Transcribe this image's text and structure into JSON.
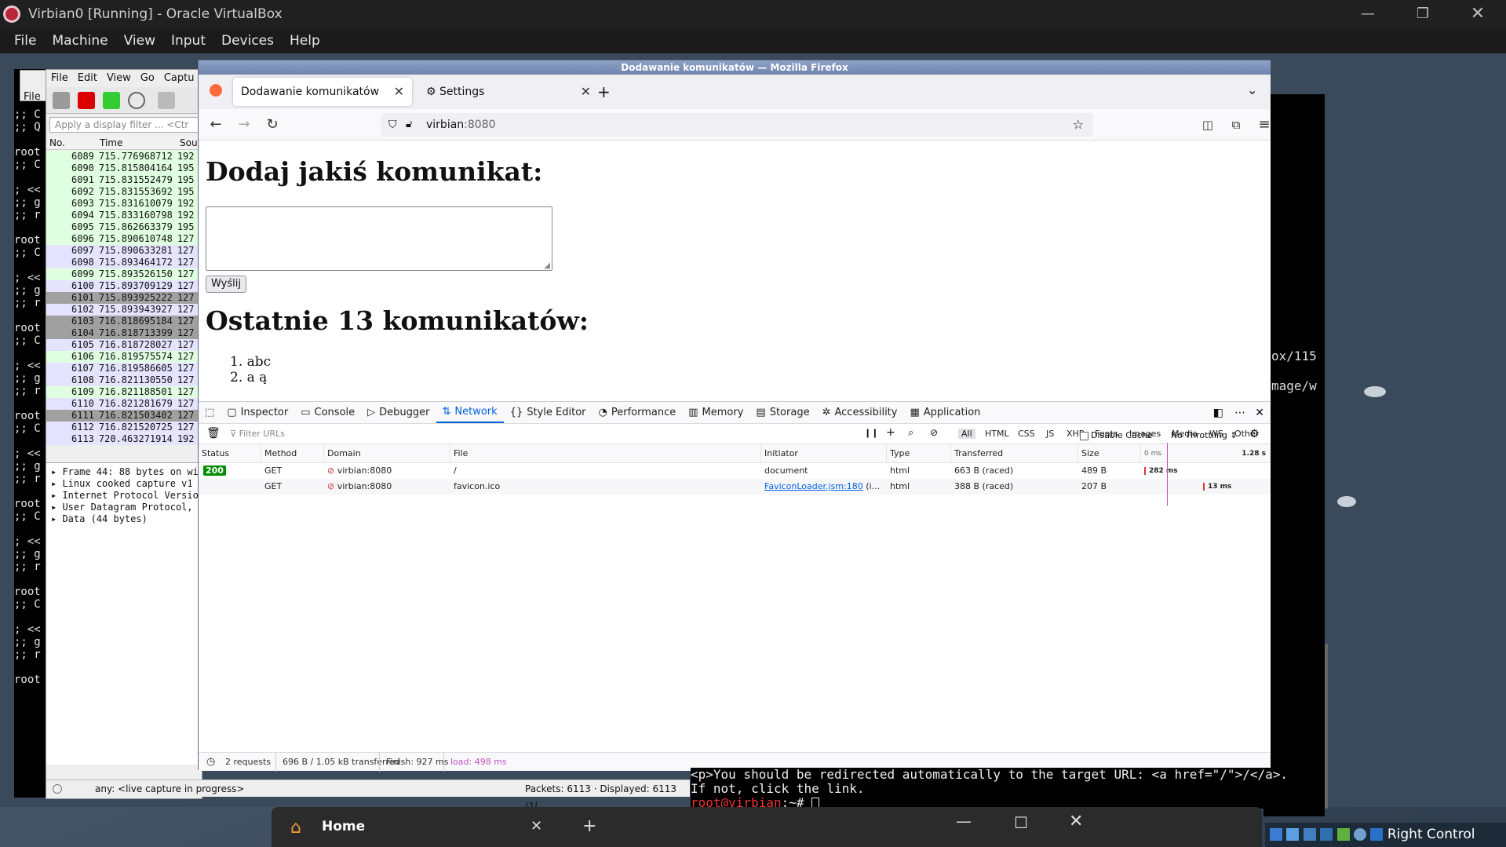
{
  "vbox": {
    "title": "Virbian0 [Running] - Oracle VirtualBox",
    "menu": [
      "File",
      "Machine",
      "View",
      "Input",
      "Devices",
      "Help"
    ],
    "host_key": "Right Control"
  },
  "term_left": {
    "lines": [
      ";; C",
      ";; Q",
      "",
      "root",
      ";; C",
      "",
      "; <<",
      ";; g",
      ";; r",
      "",
      "root",
      ";; C",
      "",
      "; <<",
      ";; g",
      ";; r",
      "",
      "root",
      ";; C",
      "",
      "; <<",
      ";; g",
      ";; r",
      "",
      "root",
      ";; C",
      "",
      "; <<",
      ";; g",
      ";; r",
      "",
      "root",
      ";; C",
      "",
      "; <<",
      ";; g",
      ";; r",
      "",
      "root",
      ";; C",
      "",
      "; <<",
      ";; g",
      ";; r",
      "",
      "root"
    ]
  },
  "term_right": {
    "line1": "ox/115",
    "line2": "mage/w"
  },
  "wireshark": {
    "menu": [
      "File",
      "Edit",
      "View",
      "Go",
      "Captu"
    ],
    "file_tab": "File",
    "filter_placeholder": "Apply a display filter ... <Ctr",
    "cols": [
      "No.",
      "Time",
      "Sou"
    ],
    "rows": [
      {
        "no": "6089",
        "time": "715.776968712",
        "src": "192",
        "color": "#e0ffe0"
      },
      {
        "no": "6090",
        "time": "715.815804164",
        "src": "195",
        "color": "#e0ffe0"
      },
      {
        "no": "6091",
        "time": "715.831552479",
        "src": "195",
        "color": "#e0ffe0"
      },
      {
        "no": "6092",
        "time": "715.831553692",
        "src": "195",
        "color": "#e0ffe0"
      },
      {
        "no": "6093",
        "time": "715.831610079",
        "src": "192",
        "color": "#e0ffe0"
      },
      {
        "no": "6094",
        "time": "715.833160798",
        "src": "192",
        "color": "#e0ffe0"
      },
      {
        "no": "6095",
        "time": "715.862663379",
        "src": "195",
        "color": "#e0ffe0"
      },
      {
        "no": "6096",
        "time": "715.890610748",
        "src": "127",
        "color": "#e0ffe0"
      },
      {
        "no": "6097",
        "time": "715.890633281",
        "src": "127",
        "color": "#e4e4ff"
      },
      {
        "no": "6098",
        "time": "715.893464172",
        "src": "127",
        "color": "#e4e4ff"
      },
      {
        "no": "6099",
        "time": "715.893526150",
        "src": "127",
        "color": "#e0ffe0"
      },
      {
        "no": "6100",
        "time": "715.893709129",
        "src": "127",
        "color": "#e4e4ff"
      },
      {
        "no": "6101",
        "time": "715.893925222",
        "src": "127",
        "color": "#a0a0a0"
      },
      {
        "no": "6102",
        "time": "715.893943927",
        "src": "127",
        "color": "#e4e4ff"
      },
      {
        "no": "6103",
        "time": "716.818695184",
        "src": "127",
        "color": "#a0a0a0"
      },
      {
        "no": "6104",
        "time": "716.818713399",
        "src": "127",
        "color": "#a0a0a0"
      },
      {
        "no": "6105",
        "time": "716.818728027",
        "src": "127",
        "color": "#e4e4ff"
      },
      {
        "no": "6106",
        "time": "716.819575574",
        "src": "127",
        "color": "#e0ffe0"
      },
      {
        "no": "6107",
        "time": "716.819586605",
        "src": "127",
        "color": "#e4e4ff"
      },
      {
        "no": "6108",
        "time": "716.821130550",
        "src": "127",
        "color": "#e4e4ff"
      },
      {
        "no": "6109",
        "time": "716.821188501",
        "src": "127",
        "color": "#e0ffe0"
      },
      {
        "no": "6110",
        "time": "716.821281679",
        "src": "127",
        "color": "#e4e4ff"
      },
      {
        "no": "6111",
        "time": "716.821503402",
        "src": "127",
        "color": "#a0a0a0"
      },
      {
        "no": "6112",
        "time": "716.821520725",
        "src": "127",
        "color": "#e4e4ff"
      },
      {
        "no": "6113",
        "time": "720.463271914",
        "src": "192",
        "color": "#e4e4ff"
      }
    ],
    "details": [
      "Frame 44: 88 bytes on wi",
      "Linux cooked capture v1",
      "Internet Protocol Versio",
      "User Datagram Protocol,",
      "Data (44 bytes)"
    ],
    "status_capture": "any: <live capture in progress>",
    "status_packets": "Packets: 6113 · Displayed: 6113 (1("
  },
  "firefox": {
    "window_title": "Dodawanie komunikatów — Mozilla Firefox",
    "tab1": "Dodawanie komunikatów",
    "tab2": "Settings",
    "url_host": "virbian",
    "url_port": ":8080",
    "page": {
      "heading1": "Dodaj jakiś komunikat:",
      "send_label": "Wyślij",
      "heading2": "Ostatnie 13 komunikatów:",
      "items": [
        "1. abc",
        "2. a ą"
      ]
    },
    "devtools": {
      "tabs": [
        "Inspector",
        "Console",
        "Debugger",
        "Network",
        "Style Editor",
        "Performance",
        "Memory",
        "Storage",
        "Accessibility",
        "Application"
      ],
      "filter_placeholder": "Filter URLs",
      "types": [
        "All",
        "HTML",
        "CSS",
        "JS",
        "XHR",
        "Fonts",
        "Images",
        "Media",
        "WS",
        "Other"
      ],
      "disable_cache": "Disable Cache",
      "throttling": "No Throttling ⇕",
      "headers": [
        "Status",
        "Method",
        "Domain",
        "File",
        "Initiator",
        "Type",
        "Transferred",
        "Size"
      ],
      "timeline_start": "0 ms",
      "timeline_end": "1.28 s",
      "rows": [
        {
          "status": "200",
          "method": "GET",
          "domain": "virbian:8080",
          "file": "/",
          "initiator": "document",
          "type": "html",
          "transferred": "663 B (raced)",
          "size": "489 B",
          "timing": "282 ms",
          "bar_start": 0.0,
          "bar_end": 0.22
        },
        {
          "status": "",
          "method": "GET",
          "domain": "virbian:8080",
          "file": "favicon.ico",
          "initiator": "FaviconLoader.jsm:180",
          "initiator_tail": " (i...",
          "type": "html",
          "transferred": "388 B (raced)",
          "size": "207 B",
          "timing": "13 ms",
          "bar_start": 0.5,
          "bar_end": 0.51
        }
      ],
      "status_requests": "2 requests",
      "status_transferred": "696 B / 1.05 kB transferred",
      "status_finish": "Finish: 927 ms",
      "status_load": "load: 498 ms"
    }
  },
  "term_bottom": {
    "line1": "<p>You should be redirected automatically to the target URL: <a href=\"/\">/</a>.",
    "line2": "If not, click the link.",
    "prompt_user": "root@virbian",
    "prompt_rest": ":~# "
  },
  "taskbar": {
    "home_label": "Home"
  }
}
